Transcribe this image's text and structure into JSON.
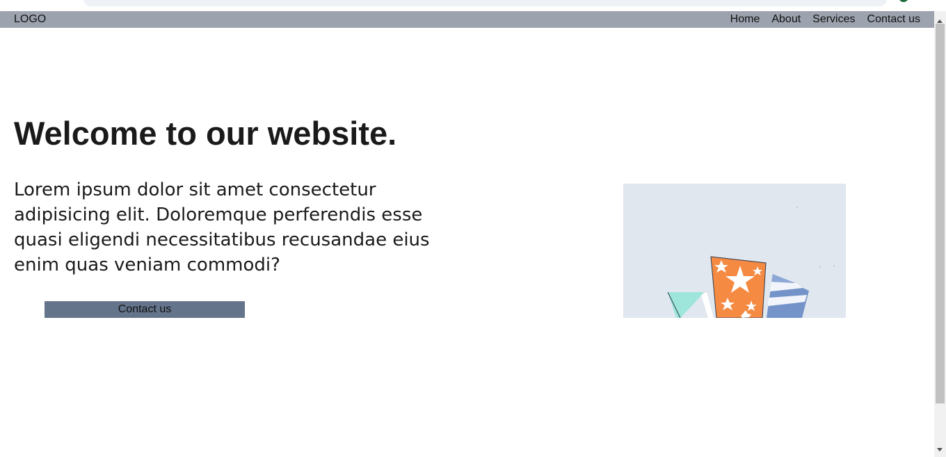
{
  "navbar": {
    "logo": "LOGO",
    "links": [
      "Home",
      "About",
      "Services",
      "Contact us"
    ],
    "background": "#9ca3af"
  },
  "hero": {
    "title": "Welcome to our website.",
    "body": "Lorem ipsum dolor sit amet consectetur adipisicing elit. Doloremque perferendis esse quasi eligendi necessitatibus recusandae eius enim quas veniam commodi?",
    "cta_label": "Contact us",
    "cta_color": "#64748b",
    "illustration_colors": {
      "background": "#e1e7ef",
      "orange": "#f58a42",
      "blue": "#7393c9",
      "teal": "#9ee6dc"
    }
  }
}
